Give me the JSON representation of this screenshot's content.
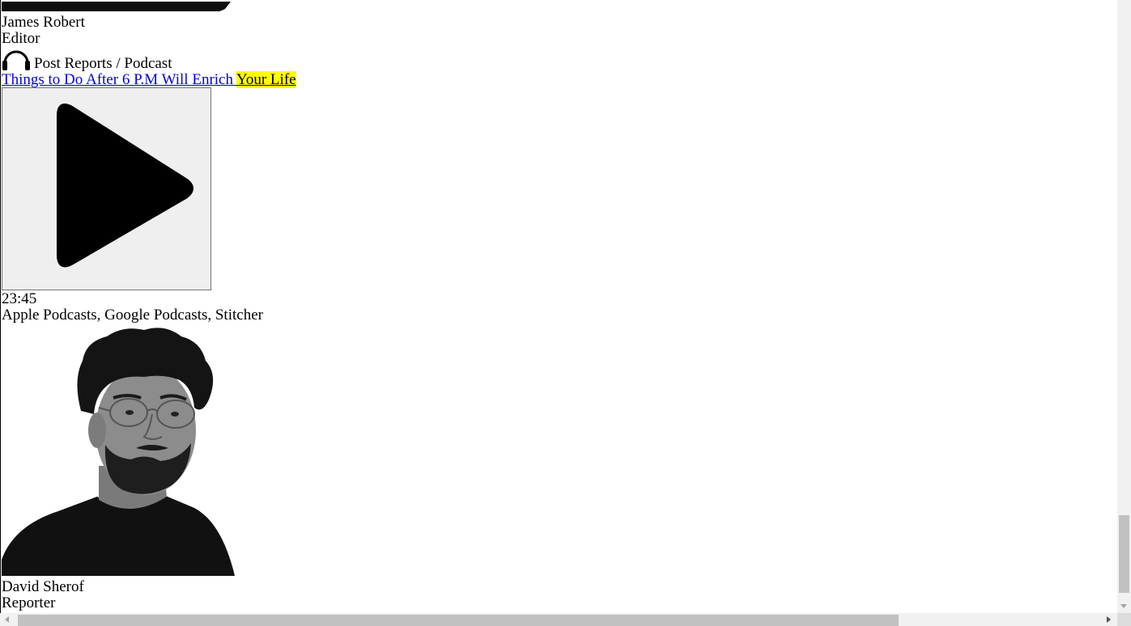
{
  "authors": [
    {
      "name": "James Robert",
      "role": "Editor"
    },
    {
      "name": "David Sherof",
      "role": "Reporter"
    }
  ],
  "podcast": {
    "category": "Post Reports / Podcast",
    "title_main": "Things to Do After 6 P.M Will Enrich ",
    "title_highlight": "Your Life",
    "duration": "23:45",
    "platforms": "Apple Podcasts, Google Podcasts, Stitcher"
  },
  "icons": {
    "category": "headphones-icon",
    "play": "play-icon"
  },
  "colors": {
    "link": "#0000ee",
    "highlight": "#ffff00",
    "button_bg": "#efefef"
  }
}
